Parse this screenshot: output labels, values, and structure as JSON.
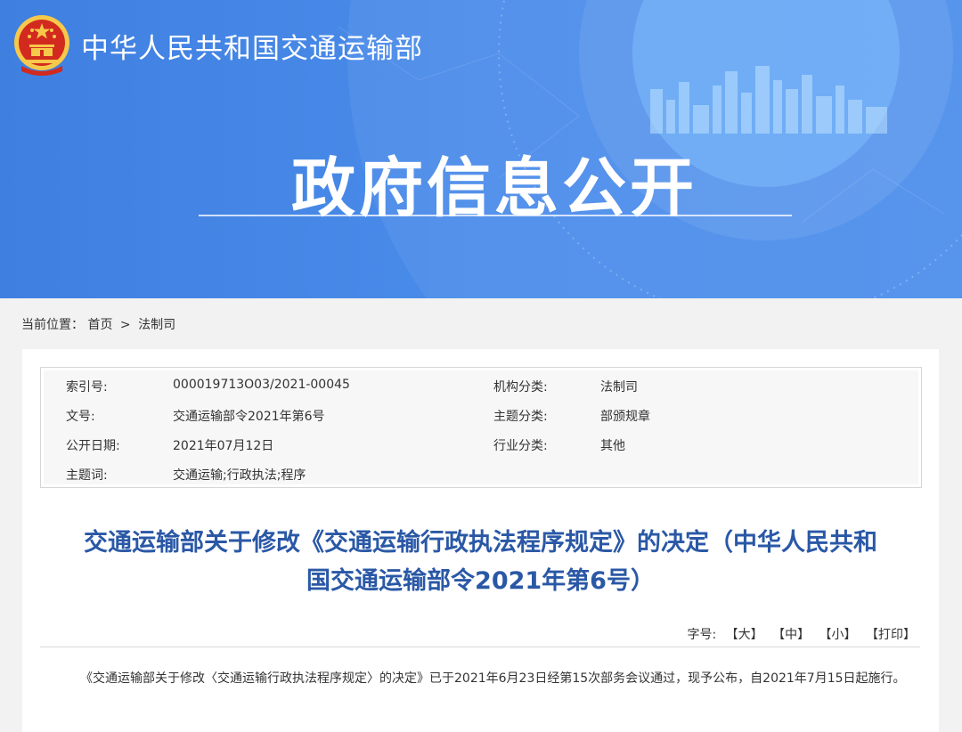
{
  "header": {
    "site_name": "中华人民共和国交通运输部",
    "banner_title": "政府信息公开"
  },
  "breadcrumb": {
    "label": "当前位置：",
    "home": "首页",
    "separator": ">",
    "current": "法制司"
  },
  "meta": {
    "rows": [
      {
        "k1": "索引号:",
        "v1": "000019713O03/2021-00045",
        "k2": "机构分类:",
        "v2": "法制司"
      },
      {
        "k1": "文号:",
        "v1": "交通运输部令2021年第6号",
        "k2": "主题分类:",
        "v2": "部颁规章"
      },
      {
        "k1": "公开日期:",
        "v1": "2021年07月12日",
        "k2": "行业分类:",
        "v2": "其他"
      },
      {
        "k1": "主题词:",
        "v1": "交通运输;行政执法;程序",
        "k2": "",
        "v2": ""
      }
    ]
  },
  "article": {
    "title_line1": "交通运输部关于修改《交通运输行政执法程序规定》的决定（中华人民共和",
    "title_line2": "国交通运输部令2021年第6号）",
    "body": "《交通运输部关于修改〈交通运输行政执法程序规定〉的决定》已于2021年6月23日经第15次部务会议通过，现予公布，自2021年7月15日起施行。"
  },
  "tools": {
    "label": "字号:",
    "large": "【大】",
    "medium": "【中】",
    "small": "【小】",
    "print": "【打印】"
  },
  "colors": {
    "banner_blue": "#4a8cea",
    "title_blue": "#2a58a6",
    "emblem_red": "#d22a1e",
    "emblem_gold": "#f6c94a"
  }
}
